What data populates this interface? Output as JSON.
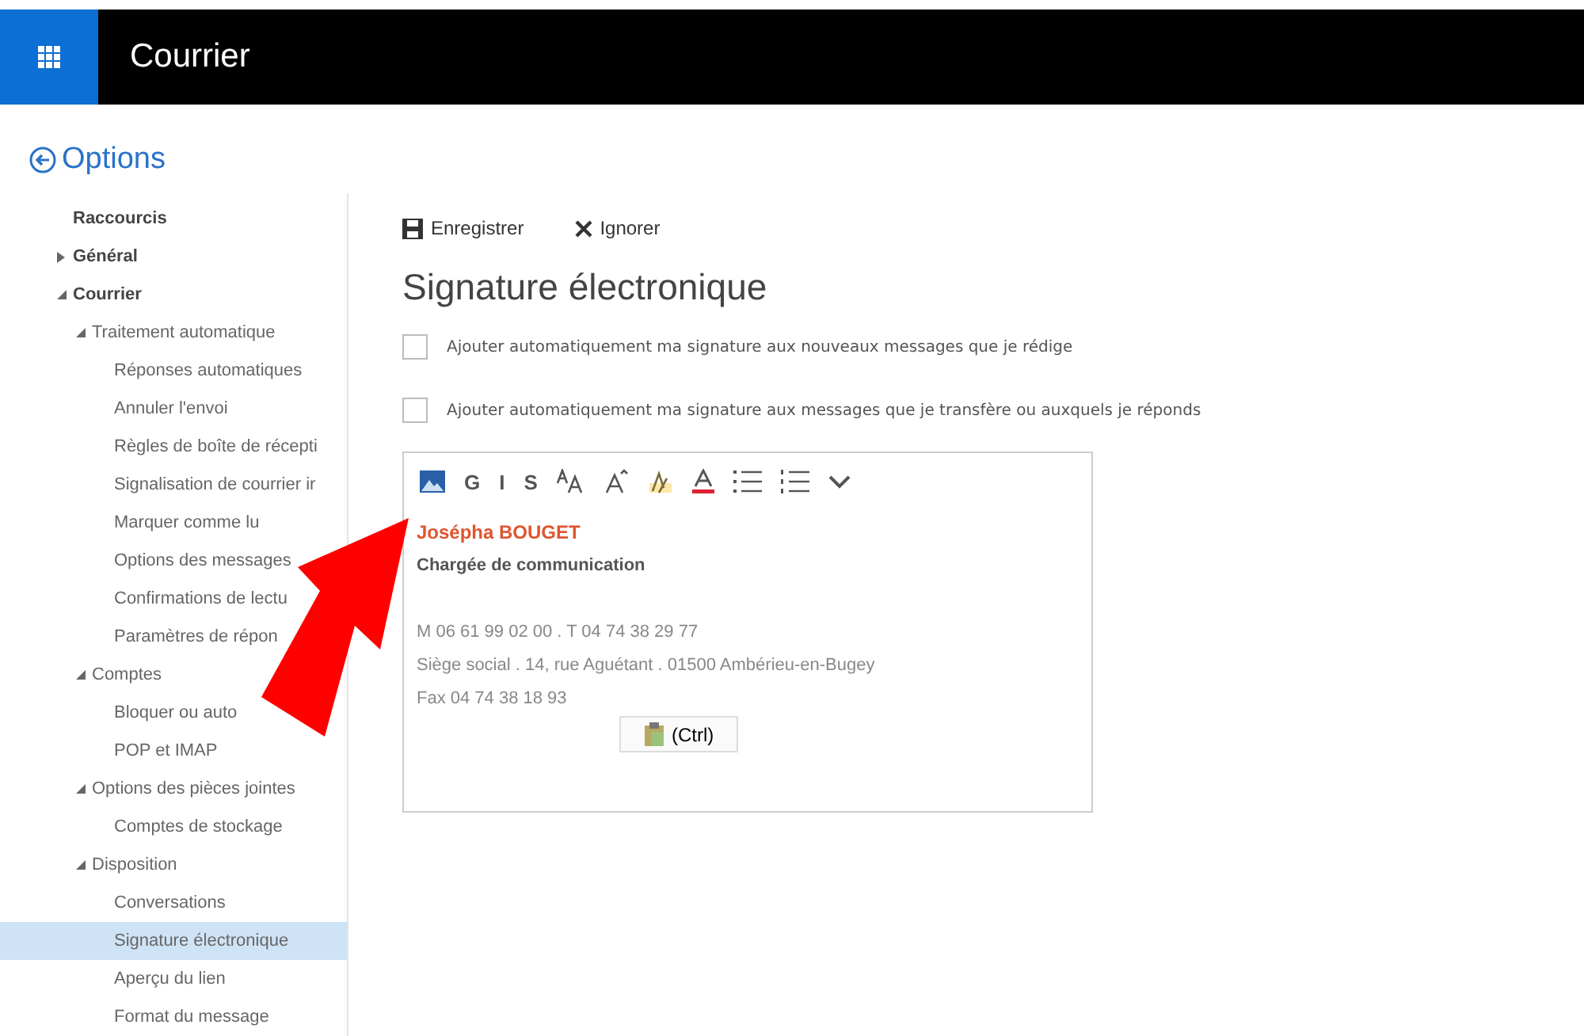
{
  "app_bar": {
    "title": "Courrier"
  },
  "options": {
    "title": "Options"
  },
  "sidebar": {
    "items": [
      {
        "label": "Raccourcis",
        "bold": true,
        "selected": false
      },
      {
        "label": "Général",
        "bold": true,
        "expanded": false,
        "selected": false
      },
      {
        "label": "Courrier",
        "bold": true,
        "expanded": true,
        "selected": false,
        "children": [
          {
            "label": "Traitement automatique",
            "expanded": true,
            "selected": false,
            "children": [
              {
                "label": "Réponses automatiques",
                "selected": false
              },
              {
                "label": "Annuler l'envoi",
                "selected": false
              },
              {
                "label": "Règles de boîte de récepti",
                "selected": false
              },
              {
                "label": "Signalisation de courrier ir",
                "selected": false
              },
              {
                "label": "Marquer comme lu",
                "selected": false
              },
              {
                "label": "Options des messages",
                "selected": false
              },
              {
                "label": "Confirmations de lectu",
                "selected": false
              },
              {
                "label": "Paramètres de répon",
                "selected": false
              }
            ]
          },
          {
            "label": "Comptes",
            "expanded": true,
            "selected": false,
            "children": [
              {
                "label": "Bloquer ou auto",
                "selected": false
              },
              {
                "label": "POP et IMAP",
                "selected": false
              }
            ]
          },
          {
            "label": "Options des pièces jointes",
            "expanded": true,
            "selected": false,
            "children": [
              {
                "label": "Comptes de stockage",
                "selected": false
              }
            ]
          },
          {
            "label": "Disposition",
            "expanded": true,
            "selected": false,
            "children": [
              {
                "label": "Conversations",
                "selected": false
              },
              {
                "label": "Signature électronique",
                "selected": true
              },
              {
                "label": "Aperçu du lien",
                "selected": false
              },
              {
                "label": "Format du message",
                "selected": false
              }
            ]
          }
        ]
      }
    ]
  },
  "commands": [
    {
      "kind": "save",
      "label": "Enregistrer"
    },
    {
      "kind": "discard",
      "label": "Ignorer"
    }
  ],
  "heading": "Signature électronique",
  "checkboxes": [
    {
      "label": "Ajouter automatiquement ma signature aux nouveaux messages que je rédige",
      "checked": false
    },
    {
      "label": "Ajouter automatiquement ma signature aux messages que je transfère ou auxquels je réponds",
      "checked": false
    }
  ],
  "toolbar": [
    {
      "kind": "image"
    },
    {
      "kind": "letter",
      "label": "G"
    },
    {
      "kind": "letter",
      "label": "I"
    },
    {
      "kind": "letter",
      "label": "S"
    },
    {
      "kind": "size"
    },
    {
      "kind": "grow"
    },
    {
      "kind": "highlight"
    },
    {
      "kind": "color"
    },
    {
      "kind": "bullets"
    },
    {
      "kind": "numbers"
    },
    {
      "kind": "more"
    }
  ],
  "signature": [
    {
      "kind": "name",
      "text": "Josépha BOUGET"
    },
    {
      "kind": "role",
      "text": "Chargée de communication"
    },
    {
      "kind": "blank"
    },
    {
      "kind": "plain",
      "text": "M 06 61 99 02 00 . T 04 74 38 29 77"
    },
    {
      "kind": "plain",
      "text": "Siège social . 14, rue Aguétant . 01500 Ambérieu-en-Bugey"
    },
    {
      "kind": "plain",
      "text": "Fax 04 74 38 18 93"
    }
  ],
  "paste_button": {
    "label": "(Ctrl)"
  },
  "annotation": {
    "kind": "arrow"
  }
}
